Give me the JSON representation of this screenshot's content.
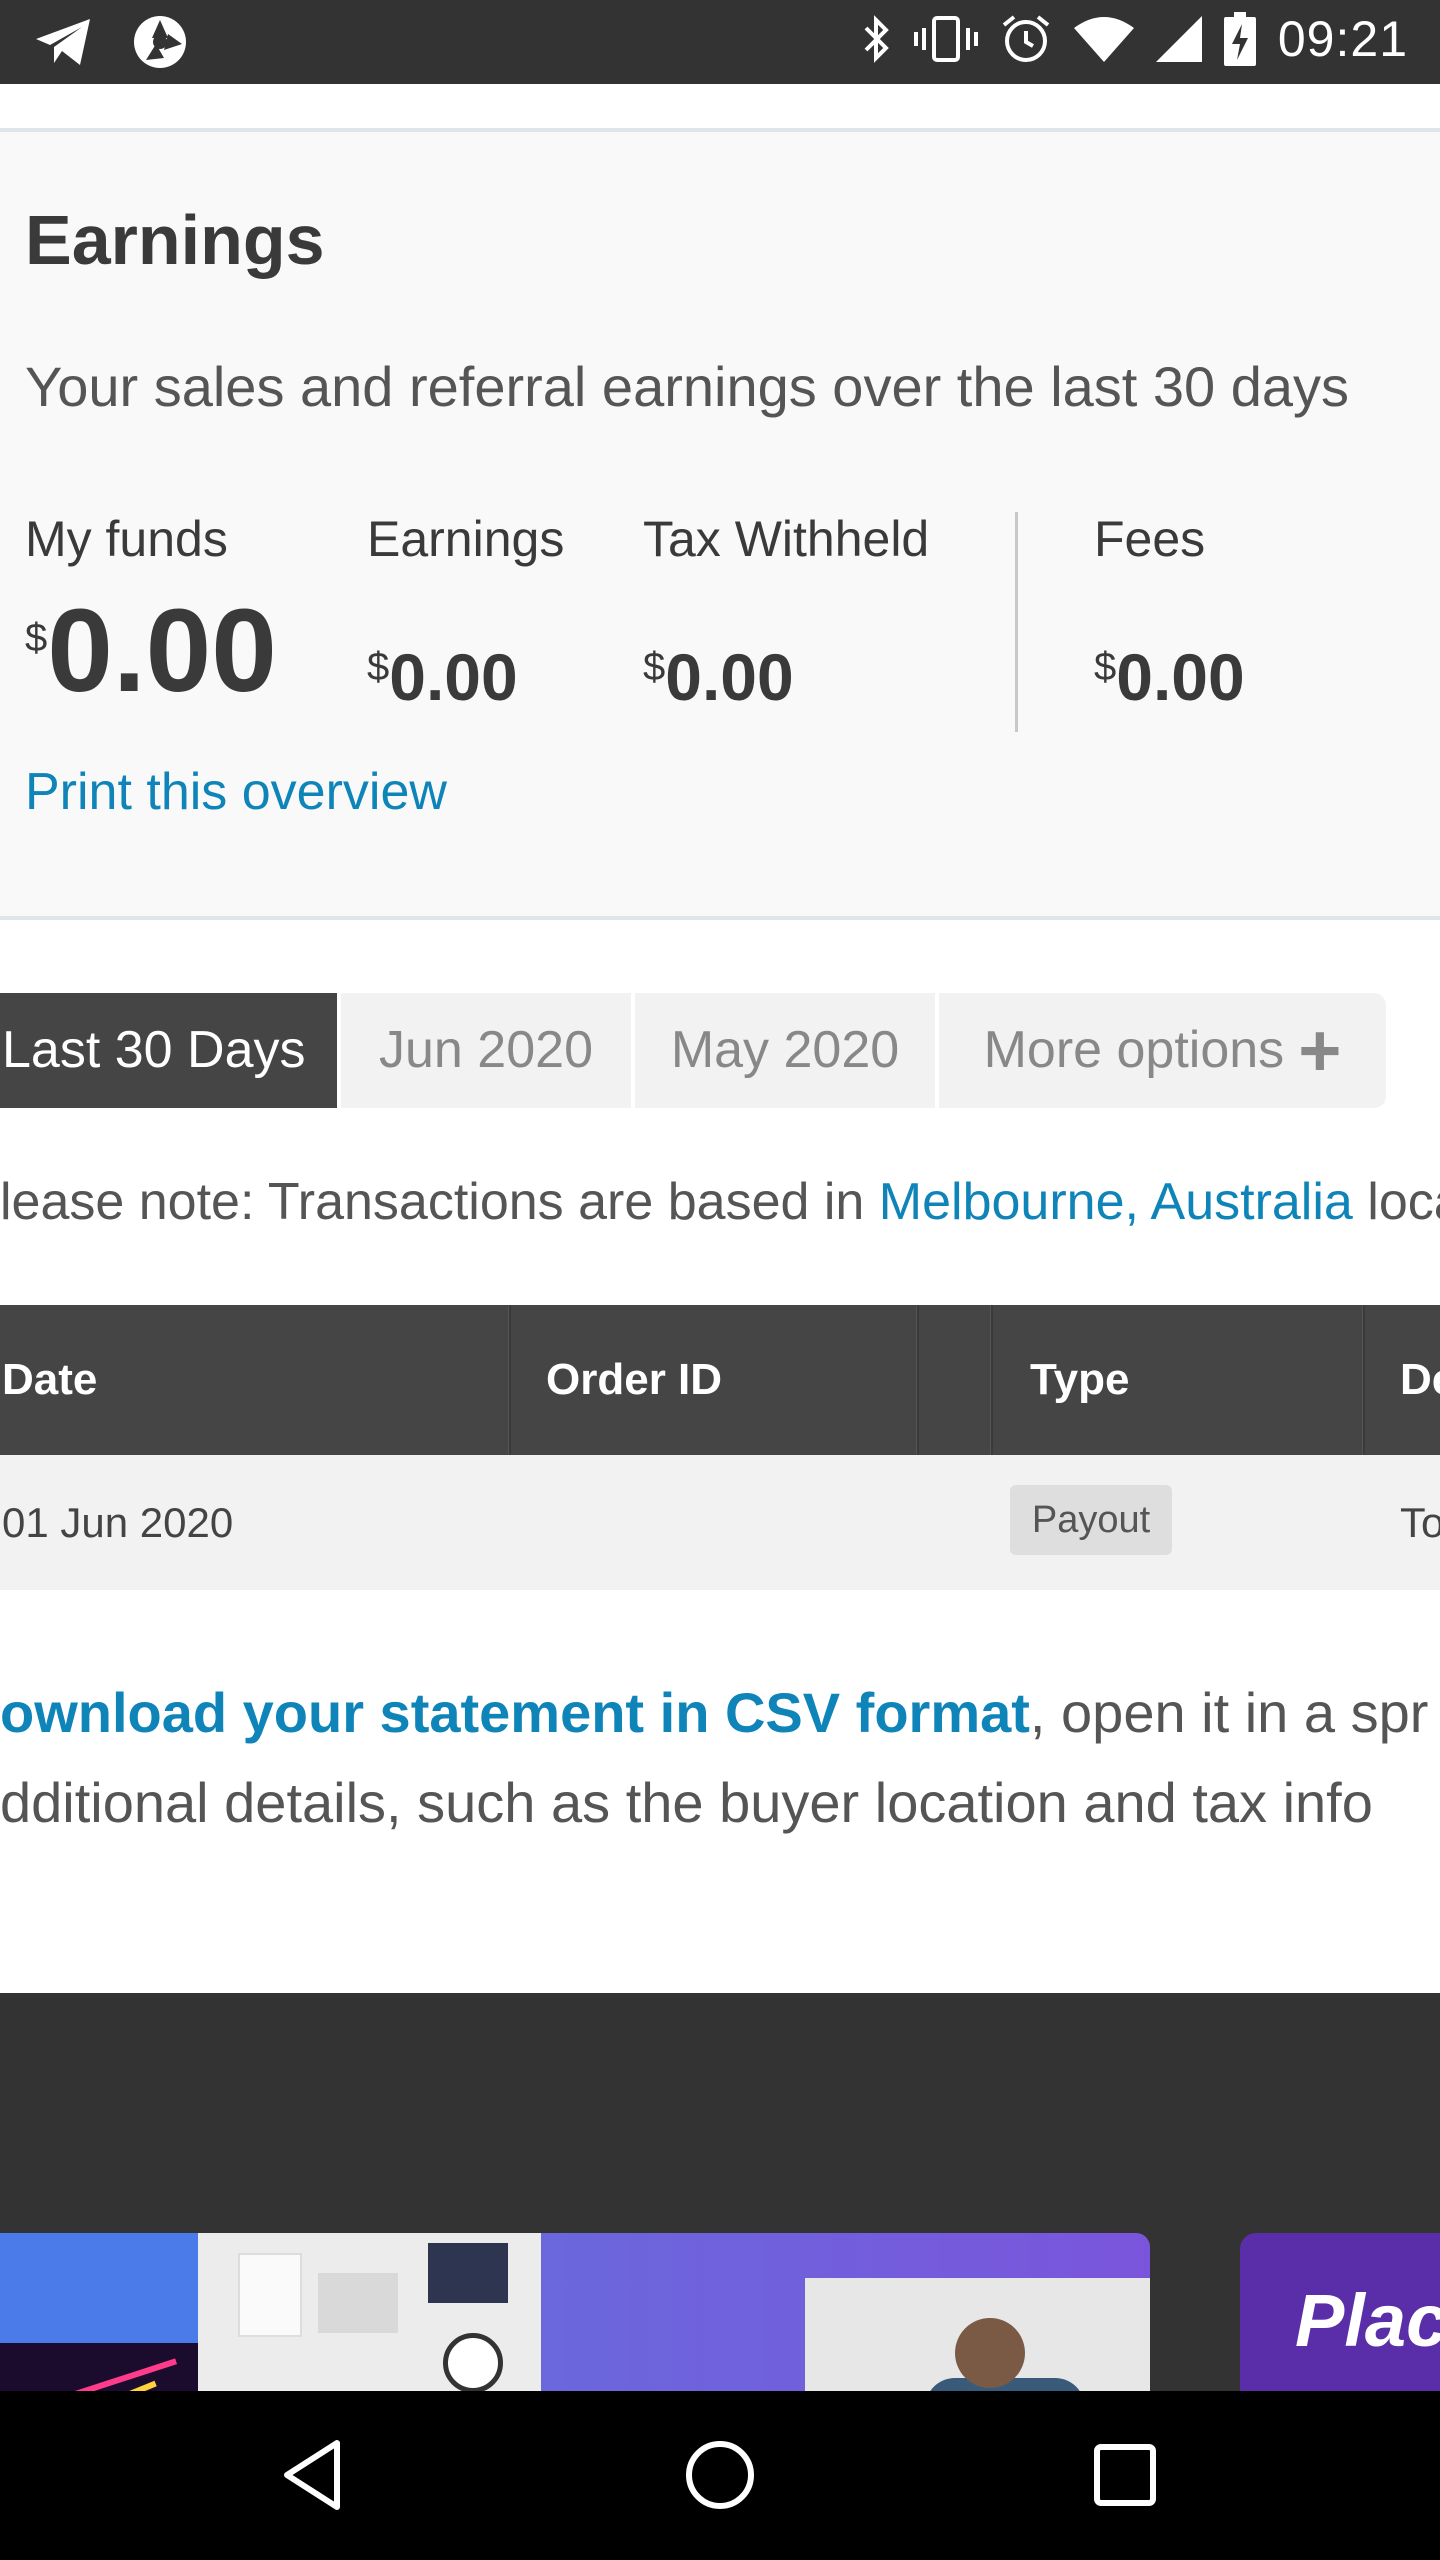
{
  "status_bar": {
    "time": "09:21",
    "left_icons": [
      "telegram-icon",
      "aperture-icon"
    ],
    "right_icons": [
      "bluetooth-icon",
      "vibrate-icon",
      "alarm-icon",
      "wifi-icon",
      "cell-signal-icon",
      "battery-charging-icon"
    ]
  },
  "earnings": {
    "title": "Earnings",
    "subtitle": "Your sales and referral earnings over the last 30 days",
    "my_funds": {
      "label": "My funds",
      "currency": "$",
      "value": "0.00"
    },
    "earnings_stat": {
      "label": "Earnings",
      "currency": "$",
      "value": "0.00"
    },
    "tax": {
      "label": "Tax Withheld",
      "currency": "$",
      "value": "0.00"
    },
    "fees": {
      "label": "Fees",
      "currency": "$",
      "value": "0.00"
    },
    "print_link": "Print this overview"
  },
  "tabs": [
    {
      "label": "Last 30 Days",
      "active": true
    },
    {
      "label": "Jun 2020",
      "active": false
    },
    {
      "label": "May 2020",
      "active": false
    },
    {
      "label": "More options",
      "active": false
    }
  ],
  "note": {
    "text": "lease note: Transactions are based in ",
    "location": "Melbourne, Australia",
    "suffix": " loca"
  },
  "table": {
    "headers": [
      "Date",
      "Order ID",
      "Type",
      "De"
    ],
    "rows": [
      {
        "date": "01 Jun 2020",
        "order_id": "",
        "type": "Payout",
        "detail": "To"
      }
    ]
  },
  "csv": {
    "link": "ownload your statement in CSV format",
    "rest_line1": ", open it in a spr",
    "line2": "dditional details, such as the buyer location and tax info"
  },
  "footer": {
    "promo_text": "Plac"
  },
  "nav": {
    "icons": [
      "back-icon",
      "home-icon",
      "recents-icon"
    ]
  }
}
